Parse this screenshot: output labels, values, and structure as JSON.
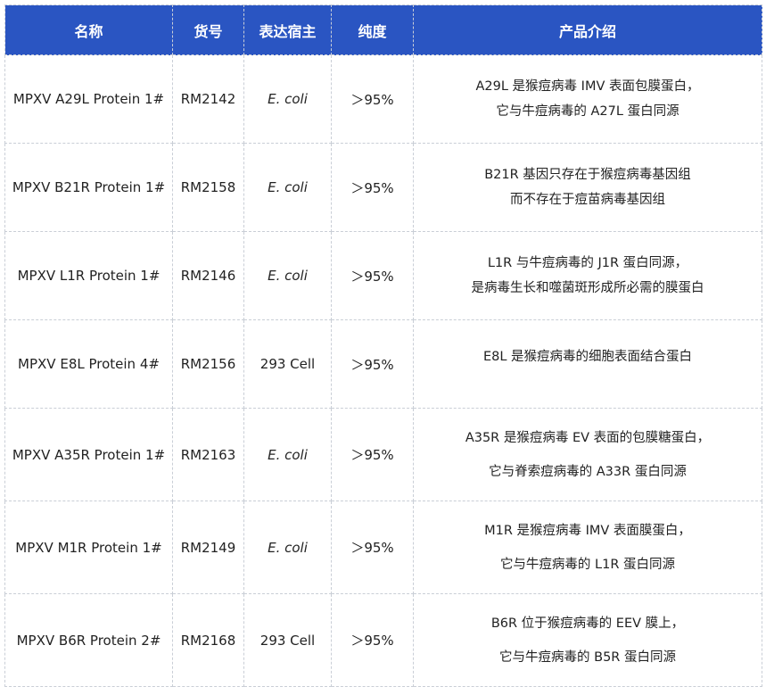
{
  "headers": {
    "name": "名称",
    "catalog": "货号",
    "host": "表达宿主",
    "purity": "纯度",
    "description": "产品介绍"
  },
  "rows": [
    {
      "name": "MPXV A29L Protein 1#",
      "catalog": "RM2142",
      "host": "E. coli",
      "purity": "＞95%",
      "desc_line1": "A29L 是猴痘病毒 IMV 表面包膜蛋白，",
      "desc_line2": "它与牛痘病毒的 A27L 蛋白同源"
    },
    {
      "name": "MPXV B21R Protein 1#",
      "catalog": "RM2158",
      "host": "E. coli",
      "purity": "＞95%",
      "desc_line1": "B21R 基因只存在于猴痘病毒基因组",
      "desc_line2": "而不存在于痘苗病毒基因组"
    },
    {
      "name": "MPXV L1R Protein 1#",
      "catalog": "RM2146",
      "host": "E. coli",
      "purity": "＞95%",
      "desc_line1": "L1R 与牛痘病毒的 J1R 蛋白同源，",
      "desc_line2": "是病毒生长和噬菌斑形成所必需的膜蛋白"
    },
    {
      "name": "MPXV E8L Protein 4#",
      "catalog": "RM2156",
      "host": "293 Cell",
      "purity": "＞95%",
      "desc_line1": "E8L 是猴痘病毒的细胞表面结合蛋白",
      "desc_line2": ""
    },
    {
      "name": "MPXV A35R Protein 1#",
      "catalog": "RM2163",
      "host": "E. coli",
      "purity": "＞95%",
      "desc_line1": "A35R 是猴痘病毒 EV 表面的包膜糖蛋白，",
      "desc_line2": "它与脊索痘病毒的 A33R 蛋白同源"
    },
    {
      "name": "MPXV M1R Protein 1#",
      "catalog": "RM2149",
      "host": "E. coli",
      "purity": "＞95%",
      "desc_line1": "M1R 是猴痘病毒 IMV 表面膜蛋白，",
      "desc_line2": "它与牛痘病毒的 L1R 蛋白同源"
    },
    {
      "name": "MPXV B6R Protein 2#",
      "catalog": "RM2168",
      "host": "293 Cell",
      "purity": "＞95%",
      "desc_line1": "B6R 位于猴痘病毒的 EEV 膜上，",
      "desc_line2": "它与牛痘病毒的 B5R 蛋白同源"
    }
  ]
}
